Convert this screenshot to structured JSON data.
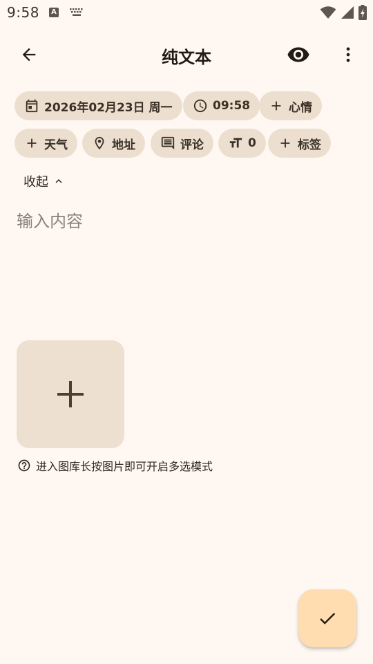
{
  "status_bar": {
    "time": "9:58",
    "indicator_letter": "A",
    "icons": [
      "text-notification-icon",
      "keyboard-icon",
      "wifi-icon",
      "cellular-signal-icon",
      "battery-charging-icon"
    ]
  },
  "app_bar": {
    "title": "纯文本",
    "icons": [
      "back-arrow-icon",
      "eye-icon",
      "more-vert-icon"
    ]
  },
  "chips": {
    "date": "2026年02月23日 周一",
    "time": "09:58",
    "mood": "心情",
    "weather": "天气",
    "location": "地址",
    "comment": "评论",
    "word_count": "0",
    "tag": "标签"
  },
  "collapse_label": "收起",
  "editor": {
    "placeholder": "输入内容",
    "value": ""
  },
  "media": {
    "hint": "进入图库长按图片即可开启多选模式"
  },
  "colors": {
    "background": "#FFF8F2",
    "chip": "#EDDFCF",
    "fab": "#FFDDB1",
    "text": "#221B14"
  }
}
